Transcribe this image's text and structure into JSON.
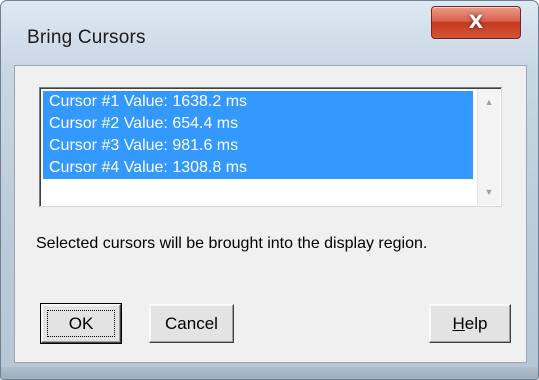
{
  "window": {
    "title": "Bring Cursors",
    "close_label": "X"
  },
  "cursor_list": {
    "items": [
      "Cursor #1  Value: 1638.2 ms",
      "Cursor #2  Value: 654.4 ms",
      "Cursor #3  Value: 981.6 ms",
      "Cursor #4  Value: 1308.8 ms"
    ],
    "selected": [
      true,
      true,
      true,
      true
    ],
    "scroll_up_icon": "▲",
    "scroll_down_icon": "▼"
  },
  "message": "Selected cursors will be brought into the display region.",
  "buttons": {
    "ok": "OK",
    "cancel": "Cancel",
    "help_underlined": "H",
    "help_rest": "elp"
  },
  "colors": {
    "selection": "#3399ff",
    "close_button": "#c5391f"
  }
}
